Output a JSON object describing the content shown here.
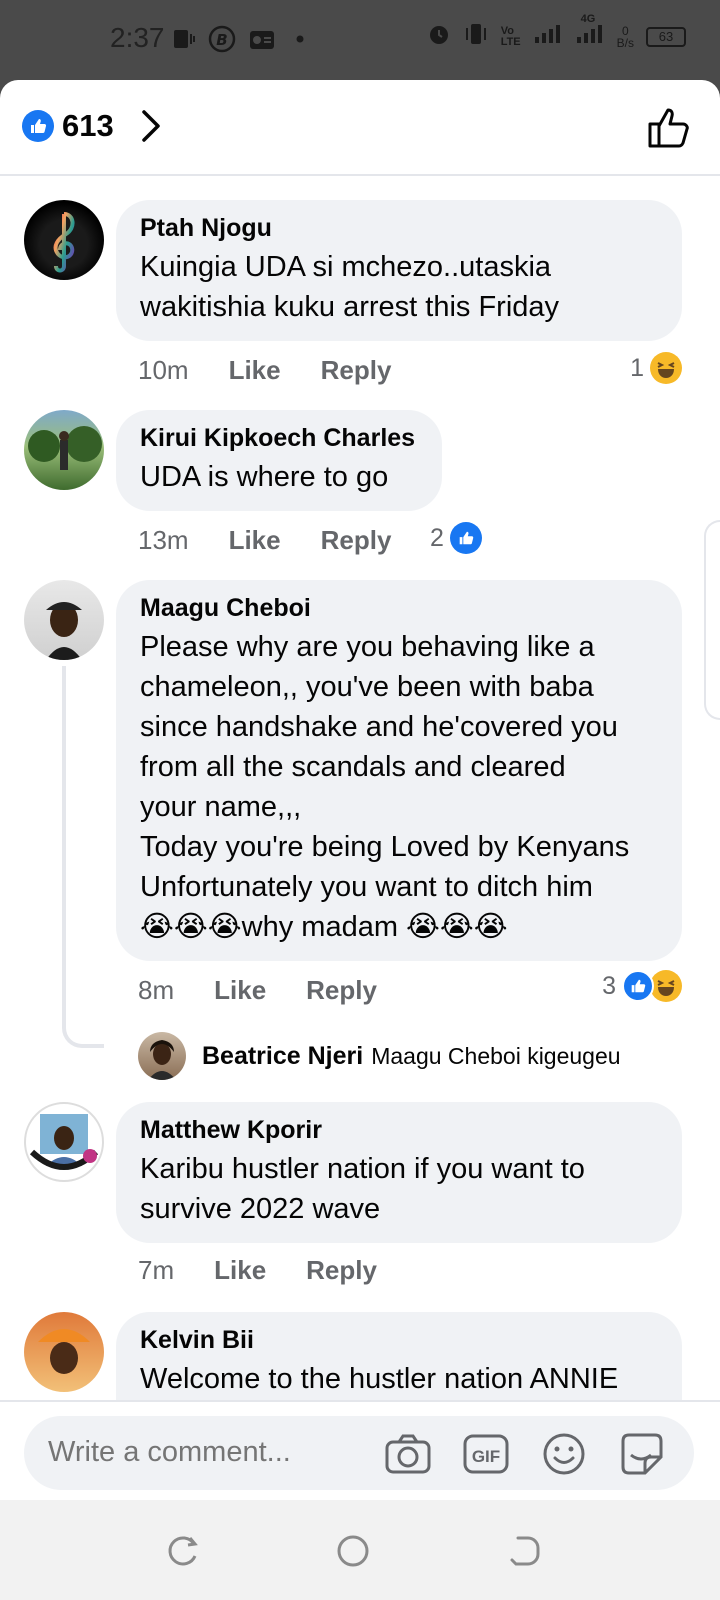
{
  "status_bar": {
    "time": "2:37",
    "battery": "63",
    "net_speed": "0\nB/s",
    "signal": "4G"
  },
  "header": {
    "like_count": "613"
  },
  "comments": [
    {
      "author": "Ptah Njogu",
      "text": "Kuingia UDA si mchezo..utaskia\nwakitishia kuku arrest this Friday",
      "time": "10m",
      "like": "Like",
      "reply": "Reply",
      "reaction_count": "1"
    },
    {
      "author": "Kirui Kipkoech Charles",
      "text": "UDA is where to go",
      "time": "13m",
      "like": "Like",
      "reply": "Reply",
      "reaction_count": "2"
    },
    {
      "author": "Maagu Cheboi",
      "text": "Please why are you behaving like a\nchameleon,, you've been with baba\nsince handshake and he'covered you\nfrom all the scandals and cleared\nyour name,,,\nToday you're being Loved by Kenyans\nUnfortunately you want to ditch him\n😭😭😭why madam 😭😭😭",
      "time": "8m",
      "like": "Like",
      "reply": "Reply",
      "reaction_count": "3"
    },
    {
      "author": "Matthew Kporir",
      "text": "Karibu hustler nation if you want to\nsurvive 2022 wave",
      "time": "7m",
      "like": "Like",
      "reply": "Reply"
    },
    {
      "author": "Kelvin Bii",
      "text": "Welcome to the hustler nation ANNIE"
    }
  ],
  "reply_preview": {
    "author": "Beatrice Njeri",
    "text": "Maagu Cheboi kigeugeu"
  },
  "composer": {
    "placeholder": "Write a comment..."
  },
  "colors": {
    "accent": "#1877f2",
    "bubble": "#f0f2f5",
    "meta": "#65676b"
  },
  "icons": [
    "like-icon",
    "chevron-right-icon",
    "thumbs-up-outline-icon",
    "camera-icon",
    "gif-icon",
    "emoji-icon",
    "sticker-icon",
    "haha-icon",
    "recent-apps-icon",
    "home-icon",
    "back-icon"
  ]
}
